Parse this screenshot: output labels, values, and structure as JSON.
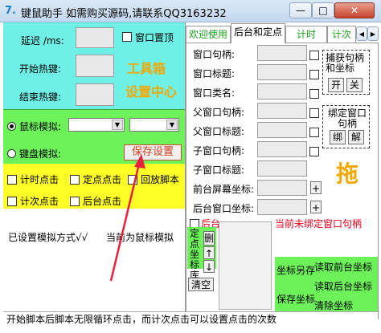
{
  "window": {
    "icon_glyph": "7.",
    "title": "键鼠助手   如需购买源码,请联系QQ3163232",
    "minimize": "—",
    "maximize": "□",
    "close": "✕"
  },
  "left": {
    "delay_label": "延迟 /ms:",
    "start_hotkey_label": "开始热键:",
    "end_hotkey_label": "结束热键:",
    "topmost_label": "窗口置顶",
    "toolbox_title": "工具箱",
    "settings_center": "设置中心",
    "mouse_sim_label": "鼠标模拟:",
    "keyboard_sim_label": "键盘模拟:",
    "save_button": "保存设置",
    "timed_click": "计时点击",
    "fixed_click": "定点点击",
    "replay_script": "回放脚本",
    "count_click": "计次点击",
    "background_click": "后台点击",
    "mode_status": "已设置模拟方式√√",
    "current_mode": "当前为鼠标模拟"
  },
  "tabs": [
    {
      "label": "欢迎使用"
    },
    {
      "label": "后台和定点"
    },
    {
      "label": "计时"
    },
    {
      "label": "计次"
    }
  ],
  "tab_scroll": {
    "left": "◀",
    "right": "▶"
  },
  "right": {
    "window_handle": "窗口句柄:",
    "window_title": "窗口标题:",
    "window_class": "窗口类名:",
    "parent_handle": "父窗口句柄:",
    "parent_title": "父窗口标题:",
    "child_handle": "子窗口句柄:",
    "child_title": "子窗口标题:",
    "fg_screen_coord": "前台屏幕坐标:",
    "bg_window_coord": "后台窗口坐标:",
    "capture_group_title": "捕获句柄和坐标",
    "open_btn": "开",
    "close_btn": "关",
    "bind_group_title": "绑定窗口句柄",
    "bind_btn": "绑",
    "unbind_btn": "解",
    "drag_text": "拖",
    "plus": "+",
    "background_label": "后台",
    "unbound_status": "当前未绑定窗口句柄",
    "coord_lib_label": "定点坐标库",
    "delete_btn": "删",
    "up_btn": "↑",
    "down_btn": "↓",
    "clear_btn": "清空",
    "save_coords_as": "坐标另存",
    "read_fg_coords": "读取前台坐标",
    "read_bg_coords": "读取后台坐标",
    "save_coords": "保存坐标",
    "clear_coords": "清除坐标"
  },
  "status_bar": "开始脚本后脚本无限循环点击，而计次点击可以设置点击的次数",
  "colors": {
    "cyan_panel": "#6ff0e6",
    "green_panel": "#6df25a",
    "yellow_panel": "#ffff28",
    "orange_text": "#f5a800",
    "red_text": "#e8001c",
    "arrow": "#e8213b"
  }
}
